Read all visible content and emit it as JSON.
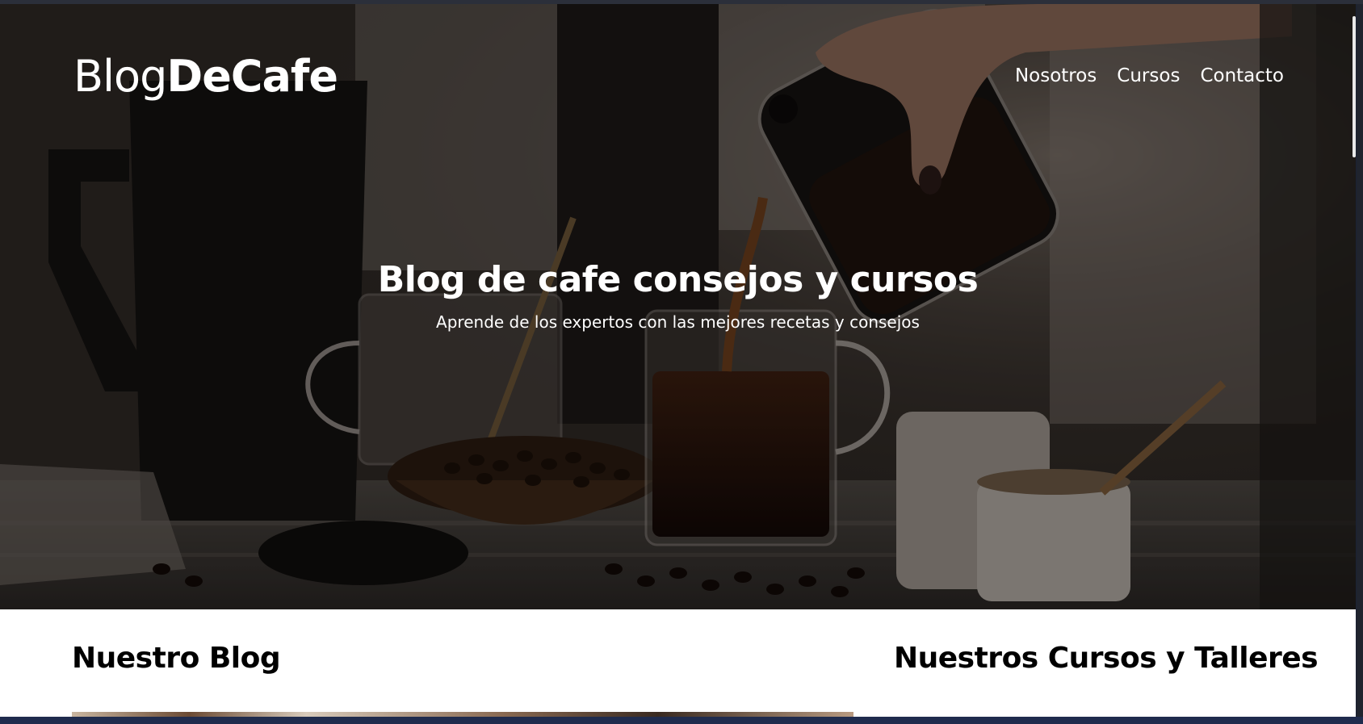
{
  "brand": {
    "logo_light": "Blog",
    "logo_bold": "DeCafe"
  },
  "nav": {
    "items": [
      "Nosotros",
      "Cursos",
      "Contacto"
    ]
  },
  "hero": {
    "title": "Blog de cafe consejos y cursos",
    "subtitle": "Aprende de los expertos con las mejores recetas y consejos",
    "image": "coffee-pour-photo"
  },
  "sections": {
    "blog_heading": "Nuestro Blog",
    "courses_heading": "Nuestros Cursos y Talleres"
  },
  "colors": {
    "hero_text": "#ffffff",
    "heading_text": "#000000",
    "content_bg": "#ffffff"
  }
}
